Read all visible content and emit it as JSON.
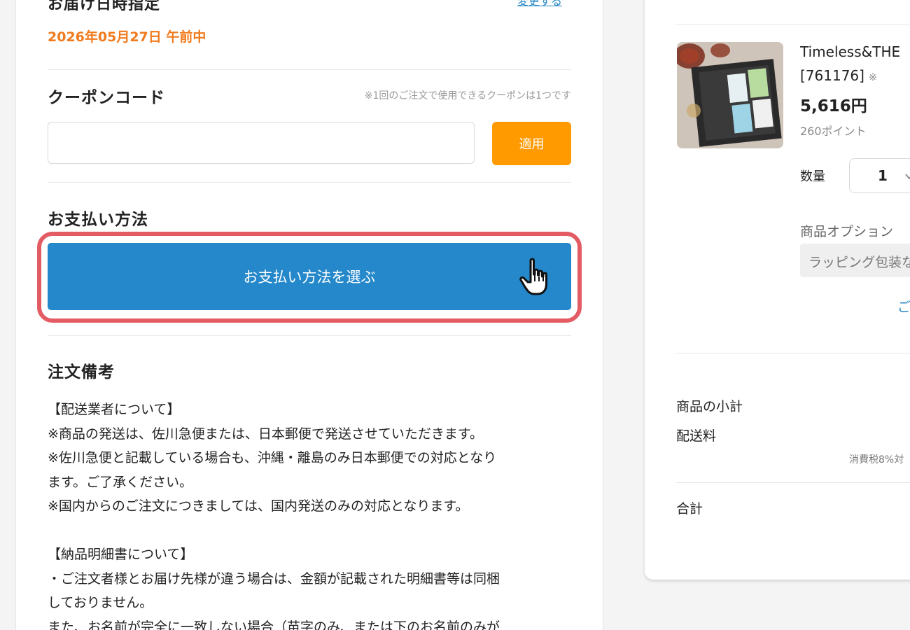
{
  "delivery": {
    "title": "お届け日時指定",
    "change_link": "変更する",
    "date": "2026年05月27日 午前中"
  },
  "coupon": {
    "title": "クーポンコード",
    "note": "※1回のご注文で使用できるクーポンは1つです",
    "input_value": "",
    "input_placeholder": "",
    "apply_label": "適用"
  },
  "payment": {
    "title": "お支払い方法",
    "button_label": "お支払い方法を選ぶ"
  },
  "remarks": {
    "title": "注文備考",
    "lines": [
      "【配送業者について】",
      "※商品の発送は、佐川急便または、日本郵便で発送させていただきます。",
      "※佐川急便と記載している場合も、沖縄・離島のみ日本郵便での対応となり",
      "ます。ご了承ください。",
      "※国内からのご注文につきましては、国内発送のみの対応となります。",
      "",
      "【納品明細書について】",
      "・ご注文者様とお届け先様が違う場合は、金額が記載された明細書等は同梱",
      "しておりません。",
      "また、お名前が完全に一致しない場合（苗字のみ、または下のお名前のみが"
    ]
  },
  "cart": {
    "product": {
      "name": "Timeless&THE",
      "code": "[761176]",
      "code_mark": "※",
      "price": "5,616円",
      "points": "260ポイント",
      "qty_label": "数量",
      "qty_value": "1",
      "option_label": "商品オプション",
      "option_value": "ラッピング包装な",
      "more_link": "ご"
    },
    "summary": {
      "subtotal_label": "商品の小計",
      "shipping_label": "配送料",
      "tax_note": "消費税8%対",
      "total_label": "合計"
    }
  },
  "colors": {
    "accent_orange": "#f07b1e",
    "apply_button": "#ff9a00",
    "pay_button": "#2488cb",
    "highlight": "#e35b63",
    "link": "#2a88c8"
  },
  "icons": {
    "cursor": "hand-pointer-icon",
    "qty_chevron": "chevron-down-icon"
  }
}
